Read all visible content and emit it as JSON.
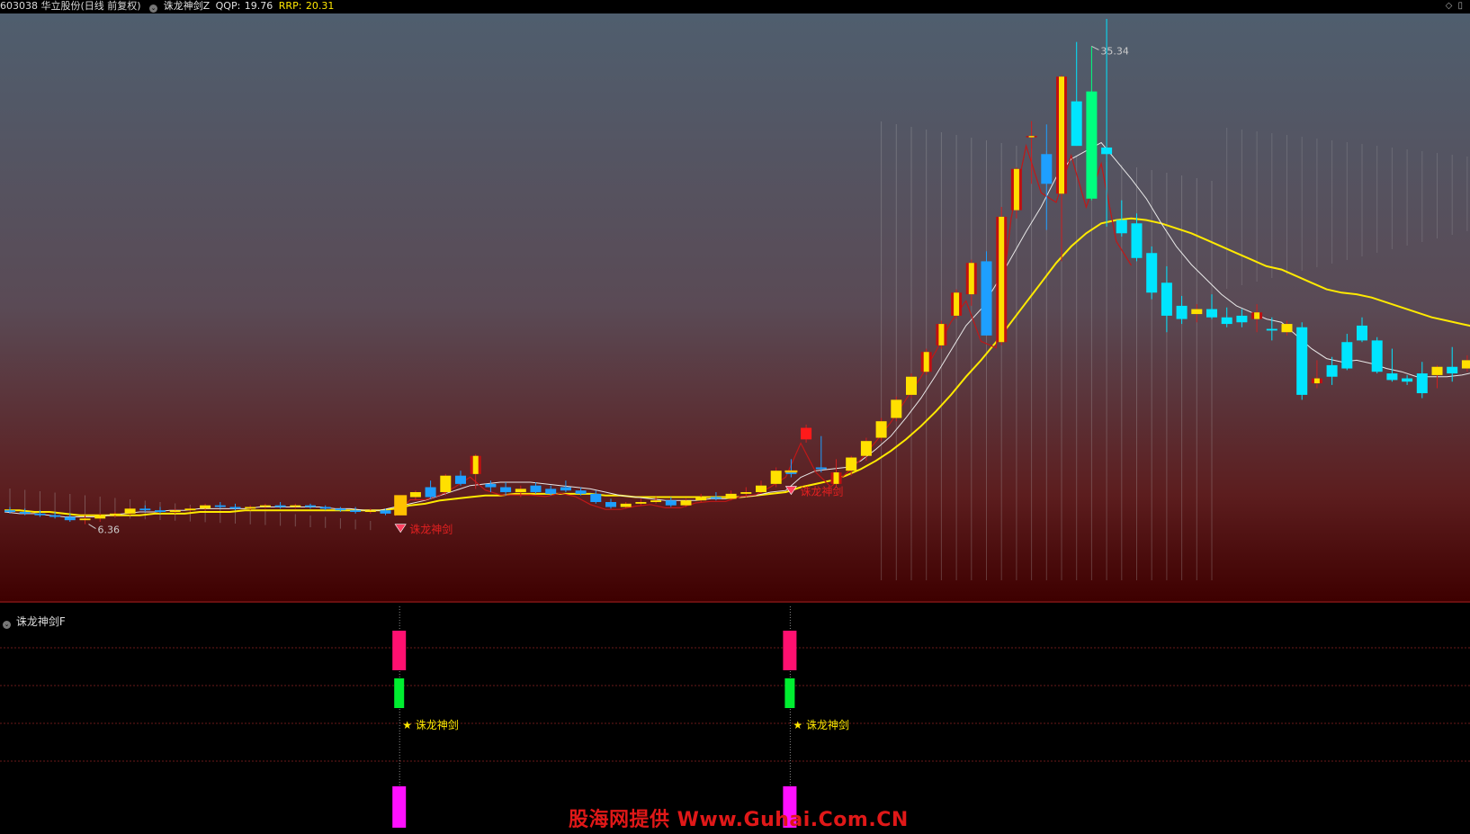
{
  "header": {
    "stock": "603038 华立股份(日线 前复权)",
    "indicator": "诛龙神剑Z",
    "qqp_label": "QQP:",
    "qqp_value": "19.76",
    "rrp_label": "RRP:",
    "rrp_value": "20.31"
  },
  "sub_panel": {
    "title": "诛龙神剑F"
  },
  "watermark": "股海网提供 Www.Guhai.Com.CN",
  "colors": {
    "up": "#ffe000",
    "down_cyan": "#00e5ff",
    "down_blue": "#1e9fff",
    "ma_white": "#e8e8e8",
    "ma_yellow": "#ffea00",
    "ma_red": "#c01818",
    "signal_text": "#e52020",
    "sub_pink": "#ff1070",
    "sub_green": "#00ee30",
    "sub_magenta": "#ff10ff"
  },
  "chart_data": [
    {
      "type": "candlestick",
      "title": "",
      "annotations": {
        "high_label": "35.34",
        "low_label": "6.36"
      },
      "signal_label": "诛龙神剑",
      "signal_indices": [
        26,
        52
      ],
      "y_range": [
        3.5,
        37
      ],
      "candles": [
        [
          7.2,
          7.4,
          7.0,
          7.1
        ],
        [
          7.1,
          7.3,
          6.9,
          7.0
        ],
        [
          7.0,
          7.2,
          6.8,
          6.9
        ],
        [
          6.9,
          7.1,
          6.7,
          6.8
        ],
        [
          6.8,
          7.0,
          6.5,
          6.6
        ],
        [
          6.6,
          6.9,
          6.36,
          6.7
        ],
        [
          6.7,
          7.0,
          6.5,
          6.9
        ],
        [
          6.9,
          7.1,
          6.8,
          7.0
        ],
        [
          7.0,
          7.4,
          6.9,
          7.3
        ],
        [
          7.3,
          7.5,
          7.1,
          7.2
        ],
        [
          7.2,
          7.4,
          7.0,
          7.1
        ],
        [
          7.1,
          7.3,
          7.0,
          7.2
        ],
        [
          7.2,
          7.4,
          7.1,
          7.3
        ],
        [
          7.3,
          7.6,
          7.2,
          7.5
        ],
        [
          7.5,
          7.7,
          7.3,
          7.4
        ],
        [
          7.4,
          7.6,
          7.2,
          7.3
        ],
        [
          7.3,
          7.5,
          7.2,
          7.4
        ],
        [
          7.4,
          7.6,
          7.3,
          7.5
        ],
        [
          7.5,
          7.7,
          7.3,
          7.4
        ],
        [
          7.4,
          7.6,
          7.3,
          7.5
        ],
        [
          7.5,
          7.6,
          7.3,
          7.4
        ],
        [
          7.4,
          7.5,
          7.2,
          7.3
        ],
        [
          7.3,
          7.4,
          7.1,
          7.2
        ],
        [
          7.2,
          7.4,
          7.0,
          7.1
        ],
        [
          7.1,
          7.3,
          7.0,
          7.2
        ],
        [
          7.2,
          7.3,
          6.9,
          7.0
        ],
        [
          7.0,
          8.0,
          6.9,
          7.9
        ],
        [
          8.0,
          8.4,
          7.8,
          8.3
        ],
        [
          8.6,
          9.0,
          7.9,
          8.0
        ],
        [
          8.3,
          9.4,
          8.1,
          9.3
        ],
        [
          9.3,
          9.6,
          8.7,
          8.8
        ],
        [
          9.4,
          10.6,
          8.5,
          10.5
        ],
        [
          8.8,
          9.0,
          8.3,
          8.6
        ],
        [
          8.6,
          8.9,
          8.1,
          8.3
        ],
        [
          8.3,
          8.7,
          8.0,
          8.5
        ],
        [
          8.7,
          8.9,
          8.2,
          8.3
        ],
        [
          8.5,
          8.7,
          8.1,
          8.2
        ],
        [
          8.6,
          9.0,
          8.3,
          8.4
        ],
        [
          8.4,
          8.6,
          8.1,
          8.2
        ],
        [
          8.2,
          8.4,
          7.6,
          7.7
        ],
        [
          7.7,
          7.9,
          7.3,
          7.4
        ],
        [
          7.4,
          7.7,
          7.3,
          7.6
        ],
        [
          7.6,
          7.9,
          7.5,
          7.7
        ],
        [
          7.7,
          8.0,
          7.6,
          7.8
        ],
        [
          7.8,
          8.0,
          7.4,
          7.5
        ],
        [
          7.5,
          7.9,
          7.4,
          7.8
        ],
        [
          7.8,
          8.2,
          7.7,
          8.0
        ],
        [
          8.0,
          8.3,
          7.8,
          7.9
        ],
        [
          7.9,
          8.4,
          7.8,
          8.2
        ],
        [
          8.2,
          8.6,
          8.0,
          8.3
        ],
        [
          8.3,
          9.0,
          8.2,
          8.7
        ],
        [
          8.8,
          9.8,
          8.6,
          9.6
        ],
        [
          9.6,
          10.3,
          9.2,
          9.4
        ],
        [
          11.5,
          12.4,
          11.3,
          12.2
        ],
        [
          9.8,
          11.7,
          9.5,
          9.7
        ],
        [
          8.8,
          10.3,
          8.6,
          9.5
        ],
        [
          9.6,
          10.5,
          9.3,
          10.4
        ],
        [
          10.5,
          11.6,
          10.2,
          11.4
        ],
        [
          11.6,
          12.8,
          11.4,
          12.6
        ],
        [
          12.8,
          14.1,
          12.6,
          13.9
        ],
        [
          14.2,
          15.5,
          14.0,
          15.3
        ],
        [
          15.6,
          17.0,
          15.4,
          16.8
        ],
        [
          17.2,
          18.7,
          17.0,
          18.5
        ],
        [
          19.0,
          20.6,
          18.8,
          20.4
        ],
        [
          20.3,
          22.4,
          19.6,
          22.2
        ],
        [
          22.3,
          22.9,
          17.8,
          17.8
        ],
        [
          17.4,
          25.6,
          17.2,
          25.0
        ],
        [
          25.4,
          28.0,
          24.9,
          27.9
        ],
        [
          29.9,
          30.8,
          27.0,
          29.9
        ],
        [
          28.8,
          30.6,
          24.2,
          27.0
        ],
        [
          26.4,
          33.6,
          22.3,
          33.5
        ],
        [
          32.0,
          35.6,
          29.3,
          29.3
        ],
        [
          32.6,
          35.34,
          26.0,
          26.1
        ],
        [
          29.2,
          37.0,
          24.4,
          28.8
        ],
        [
          24.8,
          26.0,
          23.8,
          24.0
        ],
        [
          24.6,
          25.2,
          22.3,
          22.5
        ],
        [
          22.8,
          23.2,
          20.0,
          20.4
        ],
        [
          21.0,
          22.0,
          18.0,
          19.0
        ],
        [
          19.6,
          20.2,
          18.5,
          18.8
        ],
        [
          19.1,
          19.7,
          18.6,
          19.4
        ],
        [
          19.4,
          20.3,
          18.8,
          18.9
        ],
        [
          18.9,
          19.5,
          18.3,
          18.5
        ],
        [
          19.0,
          19.4,
          18.3,
          18.6
        ],
        [
          18.8,
          19.7,
          18.0,
          19.2
        ],
        [
          18.2,
          18.9,
          17.5,
          18.1
        ],
        [
          18.0,
          18.7,
          17.8,
          18.5
        ],
        [
          18.3,
          18.6,
          13.9,
          14.2
        ],
        [
          14.9,
          16.3,
          14.6,
          15.2
        ],
        [
          16.0,
          16.5,
          14.8,
          15.3
        ],
        [
          17.4,
          17.9,
          15.7,
          15.8
        ],
        [
          18.4,
          18.9,
          17.4,
          17.5
        ],
        [
          17.5,
          17.7,
          15.5,
          15.6
        ],
        [
          15.5,
          17.0,
          15.0,
          15.1
        ],
        [
          15.2,
          15.4,
          14.8,
          15.0
        ],
        [
          15.5,
          16.2,
          14.0,
          14.3
        ],
        [
          15.4,
          16.0,
          14.6,
          15.9
        ],
        [
          15.9,
          17.1,
          15.0,
          15.5
        ],
        [
          15.8,
          16.6,
          15.6,
          16.3
        ],
        [
          17.5,
          17.9,
          16.6,
          16.8
        ],
        [
          18.5,
          18.7,
          17.0,
          17.2
        ],
        [
          17.4,
          17.9,
          16.8,
          17.1
        ],
        [
          16.8,
          17.1,
          15.9,
          16.1
        ],
        [
          16.1,
          16.5,
          15.6,
          15.8
        ],
        [
          15.8,
          16.1,
          15.4,
          15.6
        ]
      ],
      "ma_white": [
        7.1,
        7.0,
        7.0,
        6.9,
        6.8,
        6.8,
        6.8,
        6.9,
        7.0,
        7.1,
        7.1,
        7.2,
        7.2,
        7.3,
        7.3,
        7.3,
        7.3,
        7.4,
        7.4,
        7.4,
        7.4,
        7.4,
        7.3,
        7.3,
        7.2,
        7.2,
        7.4,
        7.6,
        7.8,
        8.1,
        8.4,
        8.7,
        8.8,
        8.9,
        8.9,
        8.9,
        8.8,
        8.7,
        8.6,
        8.5,
        8.3,
        8.1,
        8.0,
        7.9,
        7.8,
        7.8,
        7.8,
        7.9,
        7.9,
        8.0,
        8.1,
        8.3,
        8.4,
        9.2,
        9.6,
        9.7,
        9.8,
        10.2,
        10.9,
        11.7,
        12.8,
        14.0,
        15.4,
        16.9,
        18.4,
        19.4,
        20.9,
        22.5,
        24.1,
        25.6,
        27.4,
        28.5,
        29.0,
        29.5,
        28.4,
        27.3,
        26.1,
        24.6,
        23.2,
        22.1,
        21.2,
        20.3,
        19.6,
        19.2,
        18.8,
        18.6,
        17.8,
        17.0,
        16.4,
        16.2,
        16.3,
        16.1,
        15.8,
        15.6,
        15.3,
        15.3,
        15.3,
        15.4,
        15.6,
        15.9,
        16.0,
        15.9,
        15.8,
        15.7
      ],
      "ma_yellow": [
        7.2,
        7.2,
        7.1,
        7.1,
        7.0,
        6.9,
        6.9,
        6.9,
        6.9,
        6.9,
        7.0,
        7.0,
        7.0,
        7.1,
        7.1,
        7.1,
        7.2,
        7.2,
        7.2,
        7.2,
        7.2,
        7.2,
        7.2,
        7.2,
        7.2,
        7.2,
        7.3,
        7.5,
        7.6,
        7.8,
        7.9,
        8.0,
        8.1,
        8.1,
        8.2,
        8.2,
        8.2,
        8.2,
        8.2,
        8.2,
        8.1,
        8.1,
        8.0,
        8.0,
        8.0,
        8.0,
        8.0,
        8.0,
        8.0,
        8.0,
        8.1,
        8.2,
        8.3,
        8.6,
        8.8,
        9.0,
        9.3,
        9.7,
        10.2,
        10.8,
        11.5,
        12.3,
        13.2,
        14.2,
        15.3,
        16.3,
        17.4,
        18.6,
        19.8,
        21.0,
        22.2,
        23.2,
        24.0,
        24.6,
        24.8,
        24.9,
        24.8,
        24.6,
        24.3,
        24.0,
        23.6,
        23.2,
        22.8,
        22.4,
        22.0,
        21.8,
        21.4,
        21.0,
        20.6,
        20.4,
        20.3,
        20.1,
        19.8,
        19.5,
        19.2,
        18.9,
        18.7,
        18.5,
        18.3,
        18.1,
        17.9,
        17.7,
        17.4,
        17.1
      ],
      "ma_red_range": [
        26,
        75
      ]
    },
    {
      "type": "signal-bars",
      "title": "诛龙神剑F",
      "signal_label": "★ 诛龙神剑",
      "signal_indices": [
        26,
        52
      ]
    }
  ]
}
